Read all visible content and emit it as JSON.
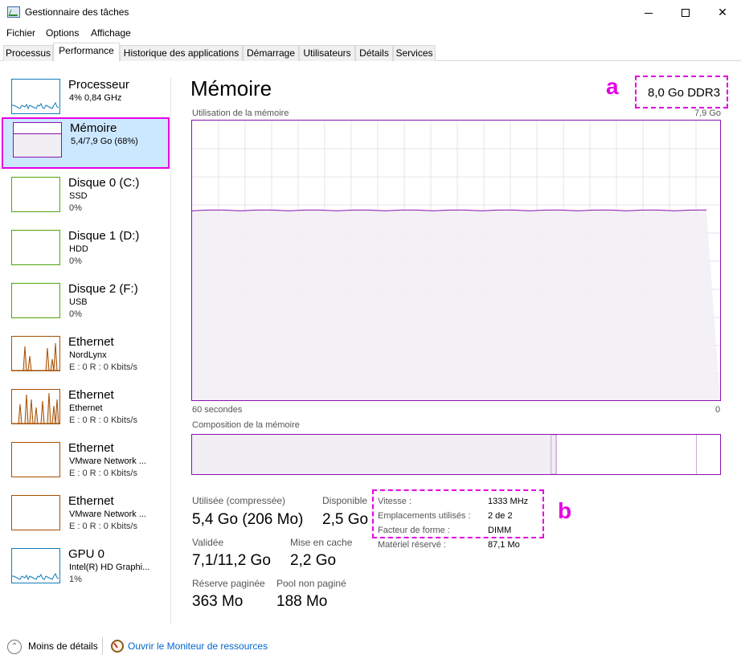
{
  "window": {
    "title": "Gestionnaire des tâches",
    "minimize": "",
    "maximize": "",
    "close": "✕"
  },
  "menu": [
    "Fichier",
    "Options",
    "Affichage"
  ],
  "tabs": [
    "Processus",
    "Performance",
    "Historique des applications",
    "Démarrage",
    "Utilisateurs",
    "Détails",
    "Services"
  ],
  "active_tab": "Performance",
  "sidebar": [
    {
      "name": "Processeur",
      "sub1": "4% 0,84 GHz",
      "sub2": "",
      "color": "#117dbb",
      "kind": "cpu"
    },
    {
      "name": "Mémoire",
      "sub1": "5,4/7,9 Go (68%)",
      "sub2": "",
      "color": "#8b12ae",
      "kind": "memory"
    },
    {
      "name": "Disque 0 (C:)",
      "sub1": "SSD",
      "sub2": "0%",
      "color": "#4da60c",
      "kind": "flat"
    },
    {
      "name": "Disque 1 (D:)",
      "sub1": "HDD",
      "sub2": "0%",
      "color": "#4da60c",
      "kind": "flat"
    },
    {
      "name": "Disque 2 (F:)",
      "sub1": "USB",
      "sub2": "0%",
      "color": "#4da60c",
      "kind": "flat"
    },
    {
      "name": "Ethernet",
      "sub1": "NordLynx",
      "sub2": "E : 0 R : 0 Kbits/s",
      "color": "#a74f01",
      "kind": "spiky1"
    },
    {
      "name": "Ethernet",
      "sub1": "Ethernet",
      "sub2": "E : 0 R : 0 Kbits/s",
      "color": "#a74f01",
      "kind": "spiky2"
    },
    {
      "name": "Ethernet",
      "sub1": "VMware Network ...",
      "sub2": "E : 0 R : 0 Kbits/s",
      "color": "#a74f01",
      "kind": "flat"
    },
    {
      "name": "Ethernet",
      "sub1": "VMware Network ...",
      "sub2": "E : 0 R : 0 Kbits/s",
      "color": "#a74f01",
      "kind": "flat"
    },
    {
      "name": "GPU 0",
      "sub1": "Intel(R) HD Graphi...",
      "sub2": "1%",
      "color": "#117dbb",
      "kind": "gpu"
    }
  ],
  "main": {
    "title": "Mémoire",
    "spec": "8,0 Go DDR3",
    "annotation_a": "a",
    "annotation_b": "b",
    "graph_label": "Utilisation de la mémoire",
    "graph_max": "7,9 Go",
    "graph_x_left": "60 secondes",
    "graph_x_right": "0",
    "usage_fraction": 0.68,
    "composition_label": "Composition de la mémoire",
    "composition": {
      "in_use": 0.68,
      "modified": 0.01,
      "standby": 0.265,
      "free": 0.045
    },
    "stats": {
      "used_label": "Utilisée (compressée)",
      "used_value": "5,4 Go (206 Mo)",
      "available_label": "Disponible",
      "available_value": "2,5 Go",
      "committed_label": "Validée",
      "committed_value": "7,1/11,2 Go",
      "cached_label": "Mise en cache",
      "cached_value": "2,2 Go",
      "paged_label": "Réserve paginée",
      "paged_value": "363 Mo",
      "nonpaged_label": "Pool non paginé",
      "nonpaged_value": "188 Mo"
    },
    "details": {
      "speed_label": "Vitesse :",
      "speed_value": "1333 MHz",
      "slots_label": "Emplacements utilisés :",
      "slots_value": "2 de 2",
      "form_label": "Facteur de forme :",
      "form_value": "DIMM",
      "reserved_label": "Matériel réservé :",
      "reserved_value": "87,1 Mo"
    }
  },
  "footer": {
    "less_details": "Moins de détails",
    "monitor_link": "Ouvrir le Moniteur de ressources"
  }
}
